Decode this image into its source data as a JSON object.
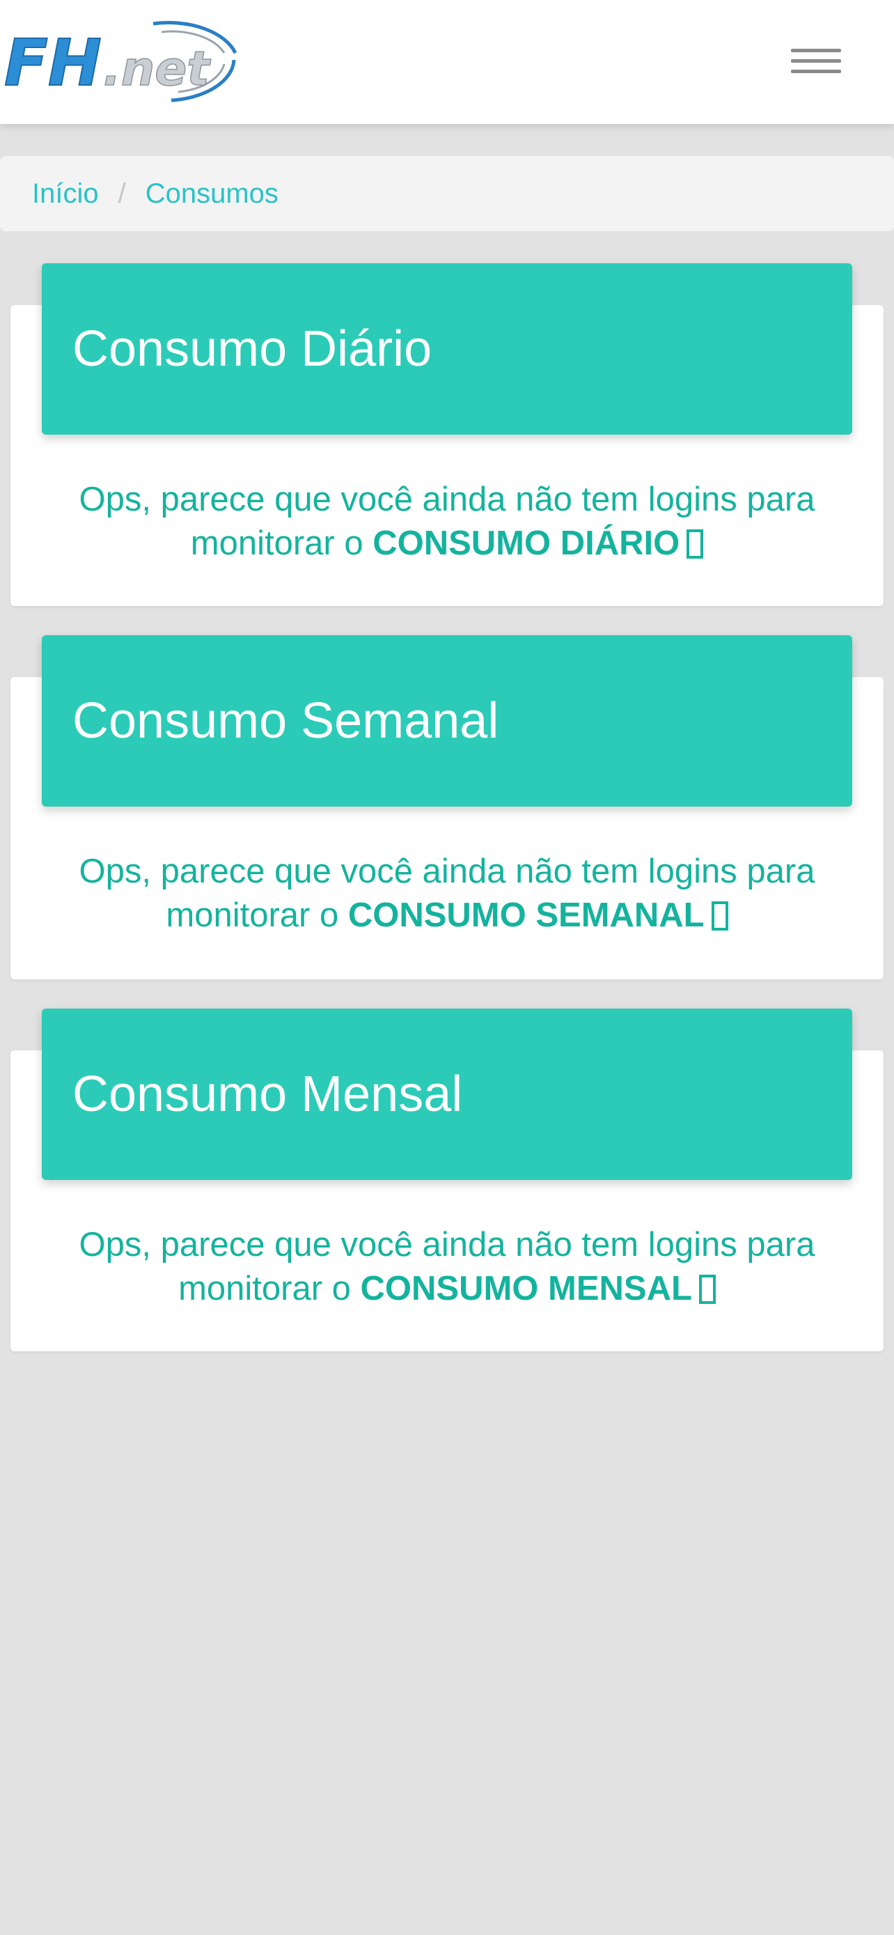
{
  "header": {
    "logo_alt": "FH.net",
    "menu_icon": "hamburger-menu-icon"
  },
  "breadcrumb": {
    "items": [
      "Início",
      "Consumos"
    ],
    "separator": "/"
  },
  "cards": [
    {
      "title": "Consumo Diário",
      "message_prefix": "Ops, parece que você ainda não tem logins para monitorar o ",
      "message_emphasis": "CONSUMO DIÁRIO",
      "icon": "missing-glyph-icon"
    },
    {
      "title": "Consumo Semanal",
      "message_prefix": "Ops, parece que você ainda não tem logins para monitorar o ",
      "message_emphasis": "CONSUMO SEMANAL",
      "icon": "missing-glyph-icon"
    },
    {
      "title": "Consumo Mensal",
      "message_prefix": "Ops, parece que você ainda não tem logins para monitorar o ",
      "message_emphasis": "CONSUMO MENSAL",
      "icon": "missing-glyph-icon"
    }
  ],
  "colors": {
    "accent": "#2bcbb8",
    "text_accent": "#14b39e",
    "link": "#2ac2c8",
    "background": "#e2e2e2"
  }
}
